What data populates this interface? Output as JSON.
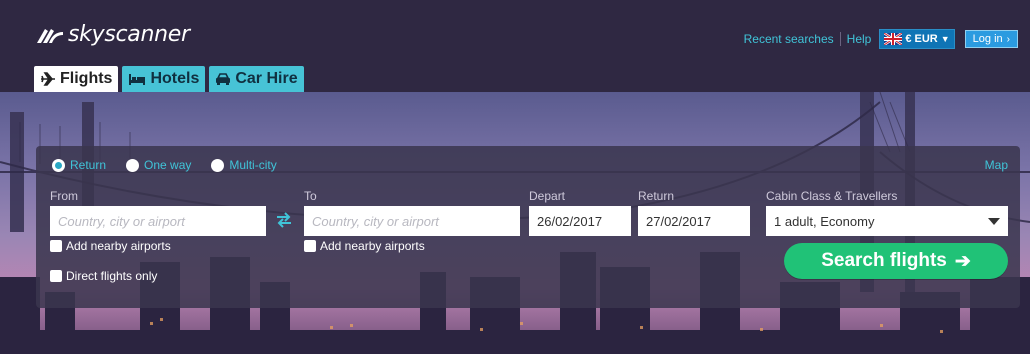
{
  "brand": {
    "name": "skyscanner"
  },
  "header": {
    "recent_searches": "Recent searches",
    "help": "Help",
    "currency": "€ EUR",
    "login": "Log in"
  },
  "tabs": [
    {
      "label": "Flights",
      "icon": "plane-icon",
      "active": true
    },
    {
      "label": "Hotels",
      "icon": "bed-icon",
      "active": false
    },
    {
      "label": "Car Hire",
      "icon": "car-icon",
      "active": false
    }
  ],
  "search": {
    "trip_types": [
      {
        "label": "Return",
        "selected": true
      },
      {
        "label": "One way",
        "selected": false
      },
      {
        "label": "Multi-city",
        "selected": false
      }
    ],
    "map_link": "Map",
    "from_label": "From",
    "from_placeholder": "Country, city or airport",
    "to_label": "To",
    "to_placeholder": "Country, city or airport",
    "depart_label": "Depart",
    "depart_value": "26/02/2017",
    "return_label": "Return",
    "return_value": "27/02/2017",
    "cabin_label": "Cabin Class & Travellers",
    "cabin_value": "1 adult, Economy",
    "nearby_from": "Add nearby airports",
    "nearby_to": "Add nearby airports",
    "direct_only": "Direct flights only",
    "submit": "Search flights"
  },
  "colors": {
    "accent": "#40c4d8",
    "button": "#20c277",
    "header_bg": "#2f2842"
  }
}
